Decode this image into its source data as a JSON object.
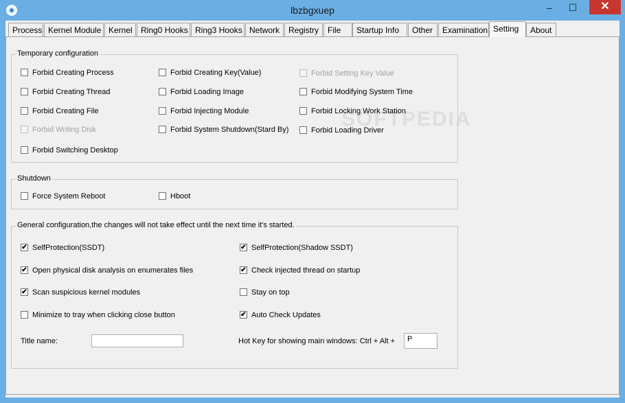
{
  "window": {
    "title": "lbzbgxuep",
    "minimize": "–",
    "maximize": "☐",
    "close": "✕"
  },
  "tabs": [
    {
      "label": "Process"
    },
    {
      "label": "Kernel Module"
    },
    {
      "label": "Kernel"
    },
    {
      "label": "Ring0 Hooks"
    },
    {
      "label": "Ring3 Hooks"
    },
    {
      "label": "Network"
    },
    {
      "label": "Registry"
    },
    {
      "label": "File"
    },
    {
      "label": "Startup Info"
    },
    {
      "label": "Other"
    },
    {
      "label": "Examination"
    },
    {
      "label": "Setting",
      "active": true
    },
    {
      "label": "About"
    }
  ],
  "temp": {
    "title": "Temporary configuration",
    "items": [
      {
        "label": "Forbid Creating Process",
        "checked": false,
        "disabled": false
      },
      {
        "label": "Forbid Creating Thread",
        "checked": false,
        "disabled": false
      },
      {
        "label": "Forbid Creating File",
        "checked": false,
        "disabled": false
      },
      {
        "label": "Forbid Writing Disk",
        "checked": false,
        "disabled": true
      },
      {
        "label": "Forbid Switching Desktop",
        "checked": false,
        "disabled": false
      },
      {
        "label": "Forbid Creating Key(Value)",
        "checked": false,
        "disabled": false
      },
      {
        "label": "Forbid Loading Image",
        "checked": false,
        "disabled": false
      },
      {
        "label": "Forbid Injecting Module",
        "checked": false,
        "disabled": false
      },
      {
        "label": "Forbid System Shutdown(Stard By)",
        "checked": false,
        "disabled": false
      },
      {
        "label": "Forbid Setting Key Value",
        "checked": false,
        "disabled": true
      },
      {
        "label": "Forbid Modifying System Time",
        "checked": false,
        "disabled": false
      },
      {
        "label": "Forbid Locking Work Station",
        "checked": false,
        "disabled": false
      },
      {
        "label": "Forbid Loading Driver",
        "checked": false,
        "disabled": false
      }
    ]
  },
  "shutdown": {
    "title": "Shutdown",
    "items": [
      {
        "label": "Force System Reboot",
        "checked": false
      },
      {
        "label": "Hboot",
        "checked": false
      }
    ]
  },
  "general": {
    "title": "General configuration,the changes will not take effect until the next time it's started.",
    "items": [
      {
        "label": "SelfProtection(SSDT)",
        "checked": true
      },
      {
        "label": "Open physical disk analysis on enumerates files",
        "checked": true
      },
      {
        "label": "Scan suspicious kernel modules",
        "checked": true
      },
      {
        "label": "Minimize to tray when clicking close button",
        "checked": false
      },
      {
        "label": "SelfProtection(Shadow SSDT)",
        "checked": true
      },
      {
        "label": "Check injected thread on startup",
        "checked": true
      },
      {
        "label": "Stay on top",
        "checked": false
      },
      {
        "label": "Auto Check Updates",
        "checked": true
      }
    ],
    "title_name_label": "Title name:",
    "title_name_value": "",
    "hotkey_label": "Hot Key for showing main windows: Ctrl + Alt +",
    "hotkey_value": "P"
  },
  "watermark": "SOFTPEDIA",
  "colors": {
    "frame": "#6aaee3",
    "close": "#c7372f",
    "client": "#f0f0f0"
  }
}
